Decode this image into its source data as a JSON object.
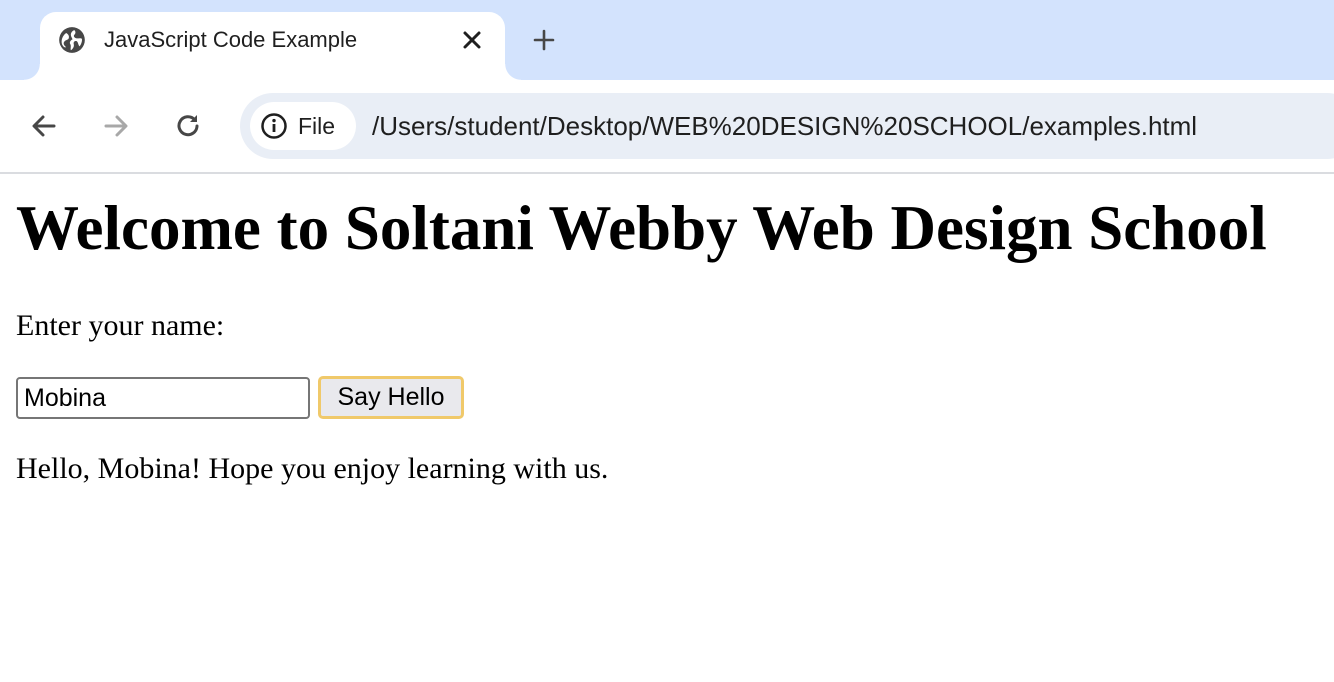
{
  "tab": {
    "title": "JavaScript Code Example",
    "favicon_icon": "globe-icon",
    "close_icon": "close-icon"
  },
  "new_tab_icon": "plus-icon",
  "toolbar": {
    "back_icon": "arrow-left-icon",
    "forward_icon": "arrow-right-icon",
    "reload_icon": "reload-icon",
    "site_info_icon": "info-icon",
    "site_info_label": "File",
    "url": "/Users/student/Desktop/WEB%20DESIGN%20SCHOOL/examples.html"
  },
  "page": {
    "heading": "Welcome to Soltani Webby Web Design School",
    "name_label": "Enter your name:",
    "name_value": "Mobina",
    "button_label": "Say Hello",
    "greeting": "Hello, Mobina! Hope you enjoy learning with us."
  },
  "colors": {
    "tabstrip_bg": "#d3e3fd",
    "omnibox_bg": "#e9eef6",
    "button_focus_ring": "#f0c96a"
  }
}
